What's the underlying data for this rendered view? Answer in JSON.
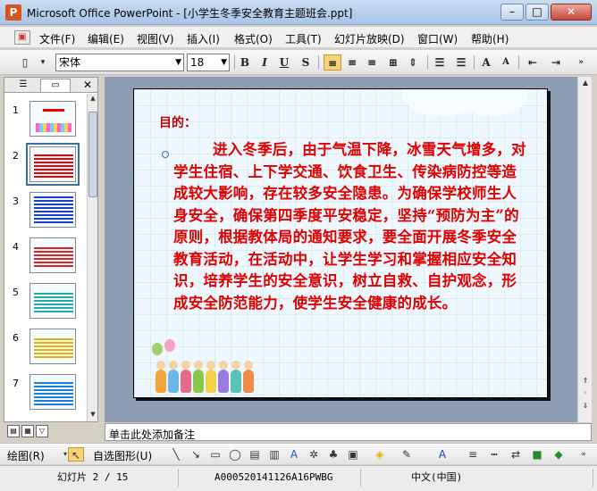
{
  "window": {
    "title": "Microsoft Office PowerPoint - [小学生冬季安全教育主题班会.ppt]",
    "app_icon": "powerpoint-icon"
  },
  "menu": {
    "items": [
      "文件(F)",
      "编辑(E)",
      "视图(V)",
      "插入(I)",
      "格式(O)",
      "工具(T)",
      "幻灯片放映(D)",
      "窗口(W)",
      "帮助(H)"
    ]
  },
  "toolbar": {
    "font_name": "宋体",
    "font_size": "18"
  },
  "slides_pane": {
    "numbers": [
      "1",
      "2",
      "3",
      "4",
      "5",
      "6",
      "7"
    ],
    "selected": "2"
  },
  "slide": {
    "heading": "目的：",
    "body": "进入冬季后，由于气温下降，冰雪天气增多，对学生住宿、上下学交通、饮食卫生、传染病防控等造成较大影响，存在较多安全隐患。为确保学校师生人身安全，确保第四季度平安稳定，坚持“预防为主”的原则，根据教体局的通知要求，要全面开展冬季安全教育活动，在活动中，让学生学习和掌握相应安全知识，培养学生的安全意识，树立自救、自护观念，形成安全防范能力，使学生安全健康的成长。"
  },
  "notes": {
    "placeholder": "单击此处添加备注"
  },
  "drawing": {
    "draw_label": "绘图(R)",
    "autoshapes_label": "自选图形(U)"
  },
  "status": {
    "slide_counter": "幻灯片 2 / 15",
    "template": "A000520141126A16PWBG",
    "language": "中文(中国)"
  },
  "colors": {
    "title_red": "#c00000",
    "body_red": "#e00000",
    "stage_bg": "#8e9db4"
  }
}
